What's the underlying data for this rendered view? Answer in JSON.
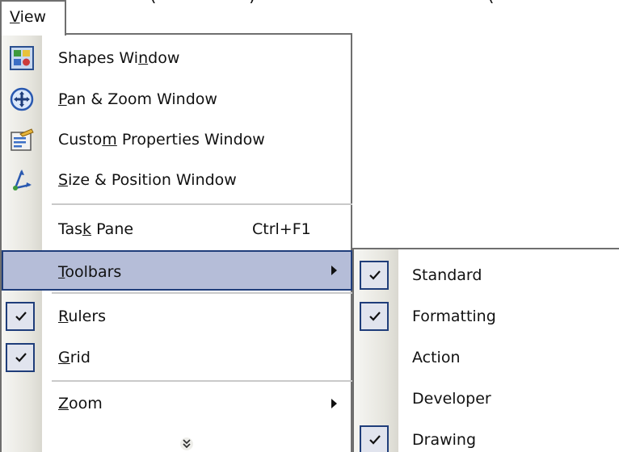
{
  "menu_title": {
    "before": "",
    "mnemonic": "V",
    "after": "iew"
  },
  "top_cutoff": {
    "left": "(",
    "middle": ")",
    "right": "("
  },
  "view_menu": {
    "items": [
      {
        "before": "Shapes Wi",
        "mnemonic": "n",
        "after": "dow",
        "icon": "shapes-window-icon"
      },
      {
        "before": "",
        "mnemonic": "P",
        "after": "an & Zoom Window",
        "icon": "pan-zoom-icon"
      },
      {
        "before": "Custo",
        "mnemonic": "m",
        "after": " Properties Window",
        "icon": "custom-properties-icon"
      },
      {
        "before": "",
        "mnemonic": "S",
        "after": "ize & Position Window",
        "icon": "size-position-icon"
      },
      {
        "before": "Tas",
        "mnemonic": "k",
        "after": " Pane",
        "shortcut": "Ctrl+F1"
      },
      {
        "before": "",
        "mnemonic": "T",
        "after": "oolbars",
        "selected": true,
        "submenu": true
      },
      {
        "before": "",
        "mnemonic": "R",
        "after": "ulers",
        "checked": true
      },
      {
        "before": "",
        "mnemonic": "G",
        "after": "rid",
        "checked": true
      },
      {
        "before": "",
        "mnemonic": "Z",
        "after": "oom",
        "submenu": true
      }
    ],
    "expand_icon": "double-chevron-down-icon"
  },
  "toolbars_submenu": {
    "items": [
      {
        "label": "Standard",
        "checked": true
      },
      {
        "label": "Formatting",
        "checked": true
      },
      {
        "label": "Action",
        "checked": false
      },
      {
        "label": "Developer",
        "checked": false
      },
      {
        "label": "Drawing",
        "checked": true
      }
    ]
  },
  "colors": {
    "selection_fill": "#b5bdd8",
    "selection_border": "#1f3d7a",
    "check_fill": "#e1e4ee"
  }
}
